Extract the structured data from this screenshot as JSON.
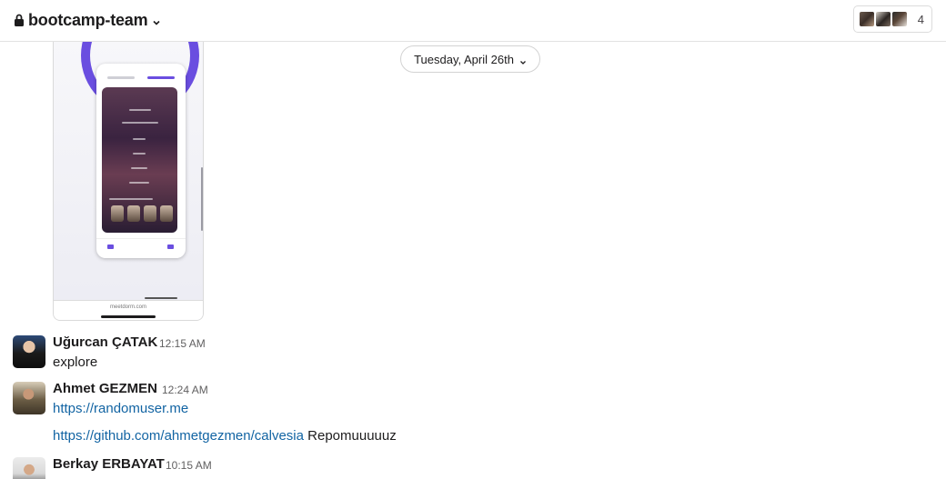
{
  "header": {
    "channel_name": "bootcamp-team",
    "member_count": "4"
  },
  "attachment": {
    "url": "meetdorm.com"
  },
  "date_divider": {
    "label": "Tuesday, April 26th"
  },
  "messages": [
    {
      "author": "Uğurcan ÇATAK",
      "time": "12:15 AM",
      "text": "explore"
    },
    {
      "author": "Ahmet GEZMEN",
      "time": "12:24 AM",
      "link1": "https://randomuser.me",
      "link2": "https://github.com/ahmetgezmen/calvesia",
      "link2_suffix": "Repomuuuuuz"
    },
    {
      "author": "Berkay ERBAYAT",
      "time": "10:15 AM"
    }
  ],
  "icons": {
    "lock": "lock-icon",
    "chevron": "chevron-down-icon"
  }
}
